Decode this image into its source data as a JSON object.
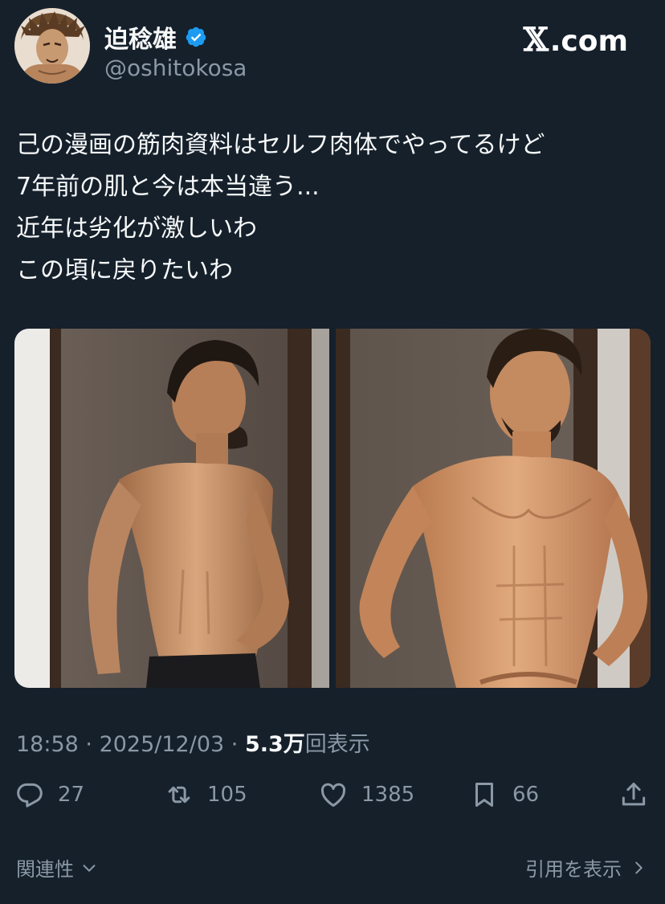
{
  "author": {
    "display_name": "迫稔雄",
    "handle": "@oshitokosa",
    "verified": true
  },
  "brand": {
    "logo": "𝕏",
    "domain": ".com"
  },
  "tweet": {
    "lines": [
      "己の漫画の筋肉資料はセルフ肉体でやってるけど",
      "7年前の肌と今は本当違う...",
      "近年は劣化が激しいわ",
      "この頃に戻りたいわ"
    ]
  },
  "meta": {
    "time": "18:58",
    "separator": " · ",
    "date": "2025/12/03",
    "views_count": "5.3万",
    "views_label": "回表示"
  },
  "actions": {
    "replies": "27",
    "reposts": "105",
    "likes": "1385",
    "bookmarks": "66"
  },
  "footer": {
    "related_label": "関連性",
    "quotes_label": "引用を表示"
  },
  "colors": {
    "background": "#15202b",
    "text": "#f7f9f9",
    "muted": "#8b98a5",
    "verified": "#1d9bf0"
  },
  "icons": {
    "verified": "verified-badge-icon",
    "reply": "speech-bubble-icon",
    "repost": "repost-arrows-icon",
    "like": "heart-icon",
    "bookmark": "bookmark-icon",
    "share": "share-upload-icon",
    "related_chevron": "chevron-down-icon",
    "quotes_chevron": "chevron-right-icon"
  }
}
